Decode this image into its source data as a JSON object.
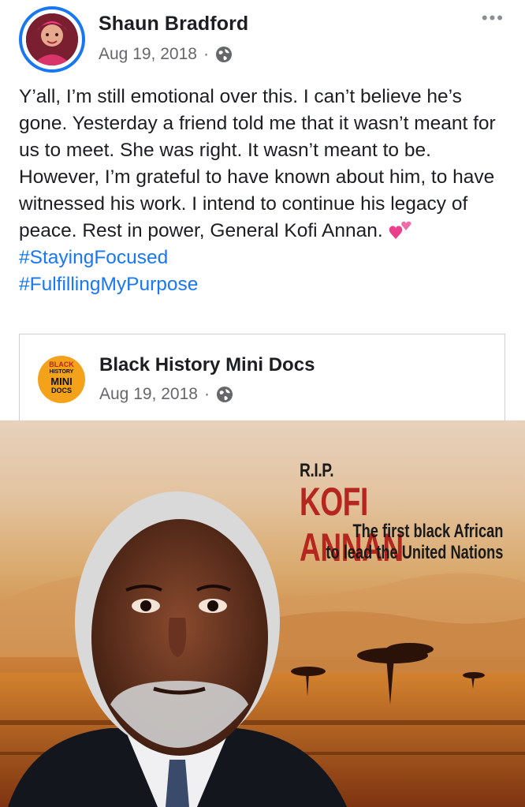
{
  "post": {
    "author": "Shaun Bradford",
    "date": "Aug 19, 2018",
    "separator": "·",
    "more_label": "•••",
    "text": "Y’all, I’m still emotional over this. I can’t believe he’s gone. Yesterday a friend told me that it wasn’t meant for us to meet. She was right. It wasn’t meant to be. However, I’m grateful to have known about him, to have witnessed his work. I intend to continue his legacy of peace. Rest in power, General Kofi Annan.",
    "hashtags": [
      "#StayingFocused",
      "#FulfillingMyPurpose"
    ],
    "emoji": "two-hearts-icon"
  },
  "shared": {
    "page_name": "Black History Mini Docs",
    "date": "Aug 19, 2018",
    "separator": "·",
    "logo_lines": [
      "BLACK",
      "HISTORY",
      "MINI",
      "DOCS"
    ]
  },
  "image": {
    "rip": "R.I.P.",
    "name": "KOFI ANNAN",
    "caption_line1": "The first black African",
    "caption_line2": "to lead the United Nations"
  },
  "colors": {
    "link": "#1877f2",
    "meta": "#65676b",
    "title_red": "#b5261e",
    "logo_orange": "#f4a21a"
  }
}
